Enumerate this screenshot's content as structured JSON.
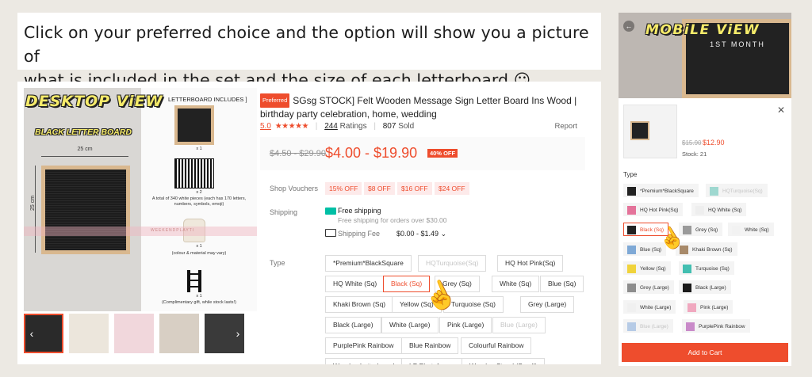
{
  "banner": {
    "line1": "Click on your preferred choice and the option will show you a picture of",
    "line2": "what is included in the set and the size of each letterboard ☺"
  },
  "desktop": {
    "overlay_title": "DESKTOP ViEW",
    "image": {
      "left_title": "BLACK LETTER BOARD",
      "width_label": "25 cm",
      "height_label": "25 cm",
      "watermark": "WEEKENDPLAYTI",
      "includes_heading": "LETTERBOARD INCLUDES ]",
      "items": [
        {
          "qty": "x 1",
          "caption": ""
        },
        {
          "qty": "x 2",
          "caption": "A total of 340 white pieces (each has 170 letters, numbers, symbols, emoji)"
        },
        {
          "qty": "x 1",
          "caption": "(colour & material may vary)"
        },
        {
          "qty": "x 1",
          "caption": "(Complimentary gift, while stock lasts!)"
        }
      ]
    },
    "badge": "Preferred",
    "title": "SGsg STOCK] Felt Wooden Message Sign Letter Board Ins Wood | birthday party celebration, home, wedding",
    "rating_score": "5.0",
    "stars": "★★★★★",
    "ratings_count": "244",
    "ratings_label": "Ratings",
    "sold_count": "807",
    "sold_label": "Sold",
    "report": "Report",
    "old_price": "$4.50 - $29.90",
    "price": "$4.00 - $19.90",
    "discount": "40% OFF",
    "vouchers_label": "Shop Vouchers",
    "vouchers": [
      "15% OFF",
      "$8 OFF",
      "$16 OFF",
      "$24 OFF"
    ],
    "shipping_label": "Shipping",
    "free_shipping": "Free shipping",
    "free_shipping_sub": "Free shipping for orders over $30.00",
    "shipping_fee_label": "Shipping Fee",
    "shipping_fee": "$0.00 - $1.49",
    "type_label": "Type",
    "options": [
      {
        "label": "*Premium*BlackSquare",
        "state": "normal"
      },
      {
        "label": "HQTurquoise(Sq)",
        "state": "disabled"
      },
      {
        "label": "HQ Hot Pink(Sq)",
        "state": "normal"
      },
      {
        "label": "HQ White (Sq)",
        "state": "normal"
      },
      {
        "label": "Black (Sq)",
        "state": "selected"
      },
      {
        "label": "Grey (Sq)",
        "state": "normal"
      },
      {
        "label": "White (Sq)",
        "state": "normal"
      },
      {
        "label": "Blue (Sq)",
        "state": "normal"
      },
      {
        "label": "Khaki Brown (Sq)",
        "state": "normal"
      },
      {
        "label": "Yellow (Sq)",
        "state": "normal"
      },
      {
        "label": "Turquoise (Sq)",
        "state": "normal"
      },
      {
        "label": "Grey (Large)",
        "state": "normal"
      },
      {
        "label": "Black (Large)",
        "state": "normal"
      },
      {
        "label": "White (Large)",
        "state": "normal"
      },
      {
        "label": "Pink (Large)",
        "state": "normal"
      },
      {
        "label": "Blue (Large)",
        "state": "disabled"
      },
      {
        "label": "PurplePink Rainbow",
        "state": "normal"
      },
      {
        "label": "Blue Rainbow",
        "state": "normal"
      },
      {
        "label": "Colourful Rainbow",
        "state": "normal"
      },
      {
        "label": "Wooden Letterboard",
        "state": "normal"
      },
      {
        "label": "LP Photoframe",
        "state": "normal"
      },
      {
        "label": "Wooden Stand (Small)",
        "state": "normal"
      }
    ]
  },
  "mobile": {
    "overlay_title": "MOBiLE ViEW",
    "board_text": "1ST MONTH",
    "old_price": "$15.90",
    "price": "$12.90",
    "stock": "Stock: 21",
    "type_label": "Type",
    "options": [
      {
        "label": "*Premium*BlackSquare",
        "state": "normal",
        "swatch": "#222222"
      },
      {
        "label": "HQTurquoise(Sq)",
        "state": "disabled",
        "swatch": "#9fd8d0"
      },
      {
        "label": "HQ Hot Pink(Sq)",
        "state": "normal",
        "swatch": "#e4739a"
      },
      {
        "label": "HQ White (Sq)",
        "state": "normal",
        "swatch": "#eeeeee"
      },
      {
        "label": "Black (Sq)",
        "state": "selected",
        "swatch": "#222222"
      },
      {
        "label": "Grey (Sq)",
        "state": "normal",
        "swatch": "#9a9a9a"
      },
      {
        "label": "White (Sq)",
        "state": "normal",
        "swatch": "#f2f2f2"
      },
      {
        "label": "Blue (Sq)",
        "state": "normal",
        "swatch": "#7fa9d6"
      },
      {
        "label": "Khaki Brown (Sq)",
        "state": "normal",
        "swatch": "#a88a6a"
      },
      {
        "label": "Yellow (Sq)",
        "state": "normal",
        "swatch": "#f0d33c"
      },
      {
        "label": "Turquoise (Sq)",
        "state": "normal",
        "swatch": "#43bfb1"
      },
      {
        "label": "Grey (Large)",
        "state": "normal",
        "swatch": "#8d8d8d"
      },
      {
        "label": "Black (Large)",
        "state": "normal",
        "swatch": "#1a1a1a"
      },
      {
        "label": "White (Large)",
        "state": "normal",
        "swatch": "#f0f0f0"
      },
      {
        "label": "Pink (Large)",
        "state": "normal",
        "swatch": "#f0a8bf"
      },
      {
        "label": "Blue (Large)",
        "state": "disabled",
        "swatch": "#b6cbe6"
      },
      {
        "label": "PurplePink Rainbow",
        "state": "normal",
        "swatch": "#c98ac9"
      }
    ],
    "add_to_cart": "Add to Cart"
  },
  "colors": {
    "accent": "#ee4d2d",
    "title_yellow": "#f6eb6a"
  }
}
